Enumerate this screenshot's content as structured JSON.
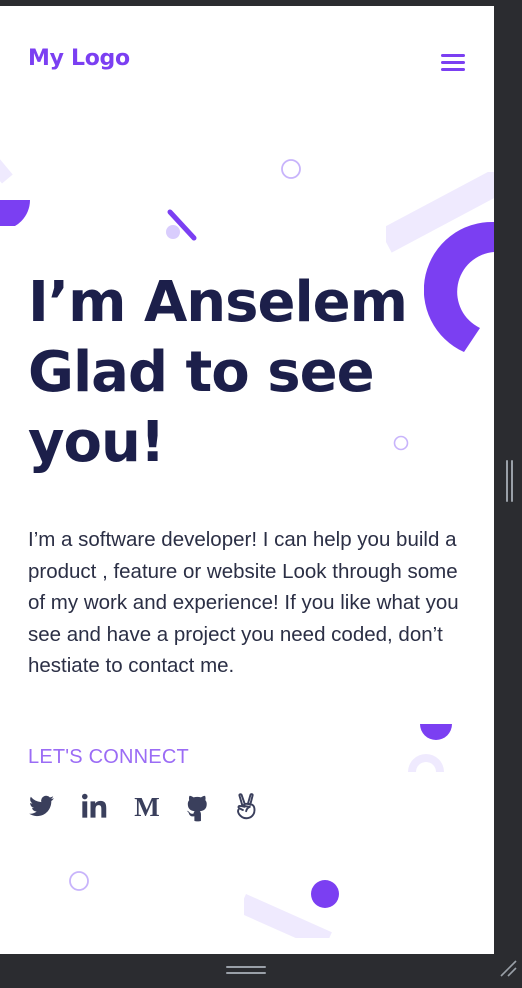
{
  "header": {
    "logo": "My Logo",
    "menu_icon": "hamburger-menu-icon"
  },
  "hero": {
    "title_line1": "I’m Anselem",
    "title_line2": "Glad to see",
    "title_line3": "you!",
    "description": "I’m a software developer! I can help you build a product , feature or website Look through some of my work and experience! If you like what you see and have a project you need coded, don’t hestiate to contact me."
  },
  "connect": {
    "label": "LET'S CONNECT",
    "socials": [
      {
        "name": "Twitter",
        "icon": "twitter-icon"
      },
      {
        "name": "LinkedIn",
        "icon": "linkedin-icon"
      },
      {
        "name": "Medium",
        "icon": "medium-icon"
      },
      {
        "name": "GitHub",
        "icon": "github-icon"
      },
      {
        "name": "AngelList",
        "icon": "angellist-icon"
      }
    ]
  },
  "colors": {
    "accent": "#7b3ff2",
    "accent_light": "#9b6cf5",
    "heading": "#1c1f4a",
    "body_text": "#2b2f45",
    "social_icon": "#3a3f5c",
    "decor_soft": "#efeafe",
    "frame": "#2b2c30"
  }
}
